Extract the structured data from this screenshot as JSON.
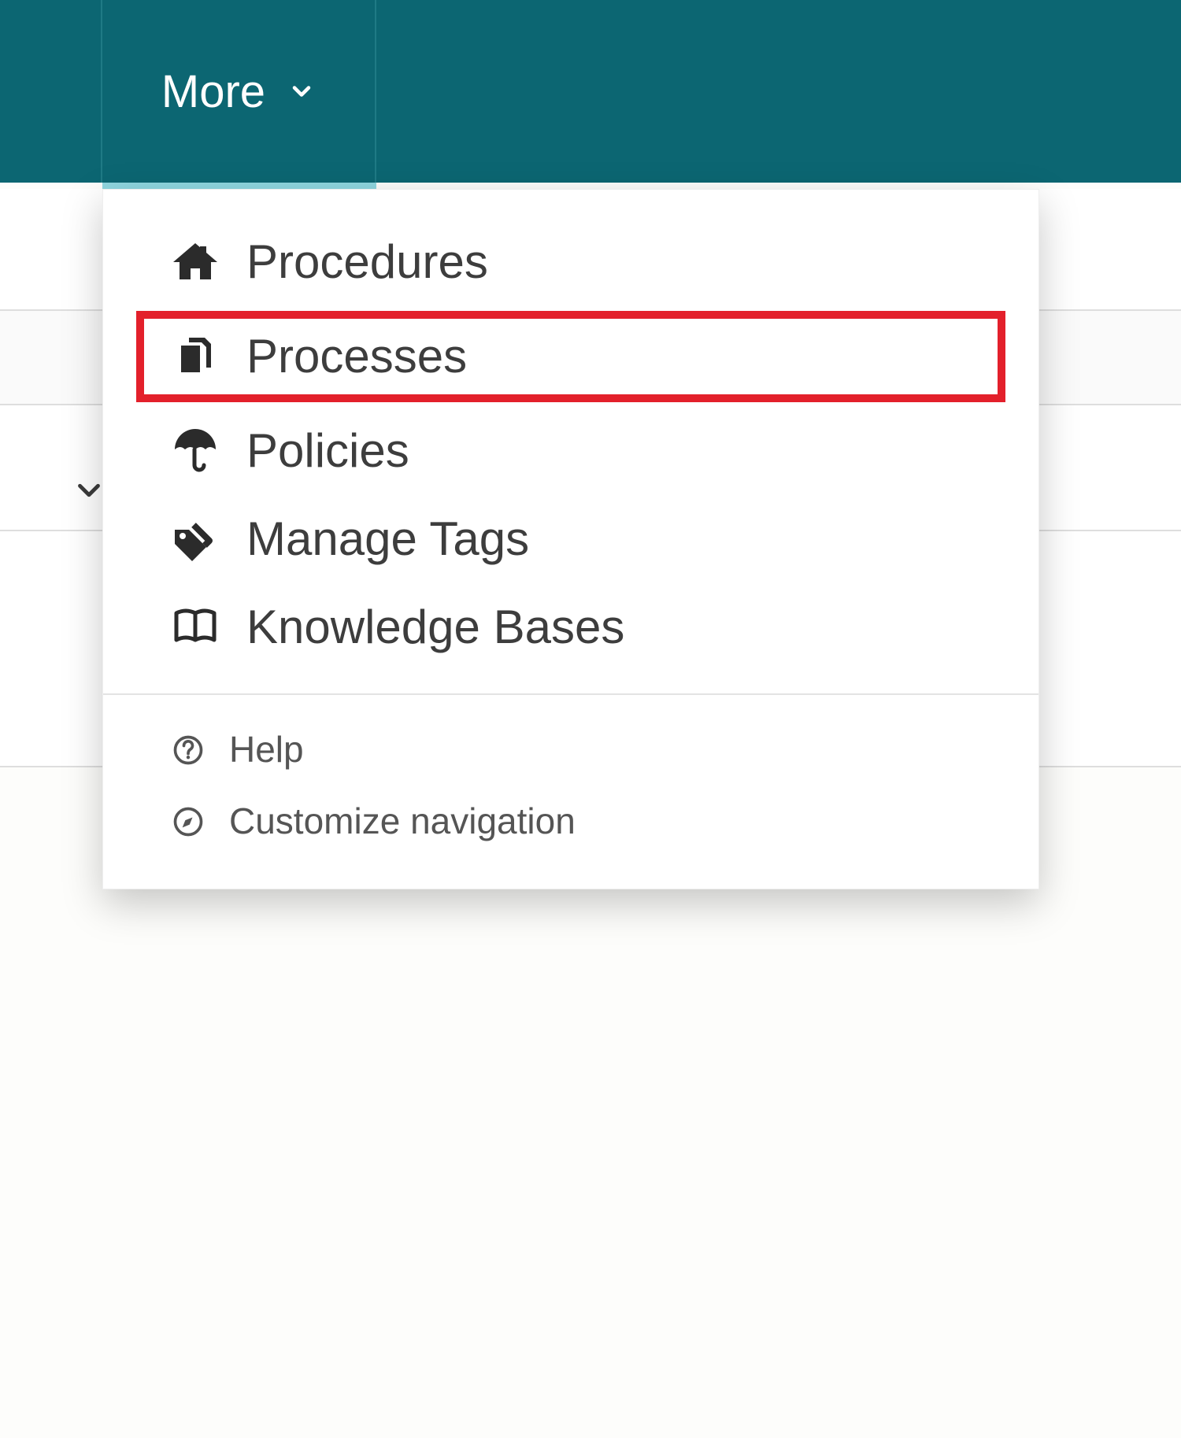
{
  "topbar": {
    "more_label": "More"
  },
  "menu": {
    "items": [
      {
        "label": "Procedures",
        "icon": "home-icon",
        "highlight": false
      },
      {
        "label": "Processes",
        "icon": "files-icon",
        "highlight": true
      },
      {
        "label": "Policies",
        "icon": "umbrella-icon",
        "highlight": false
      },
      {
        "label": "Manage Tags",
        "icon": "tags-icon",
        "highlight": false
      },
      {
        "label": "Knowledge Bases",
        "icon": "book-icon",
        "highlight": false
      }
    ],
    "footer": [
      {
        "label": "Help",
        "icon": "help-icon"
      },
      {
        "label": "Customize navigation",
        "icon": "compass-icon"
      }
    ]
  }
}
